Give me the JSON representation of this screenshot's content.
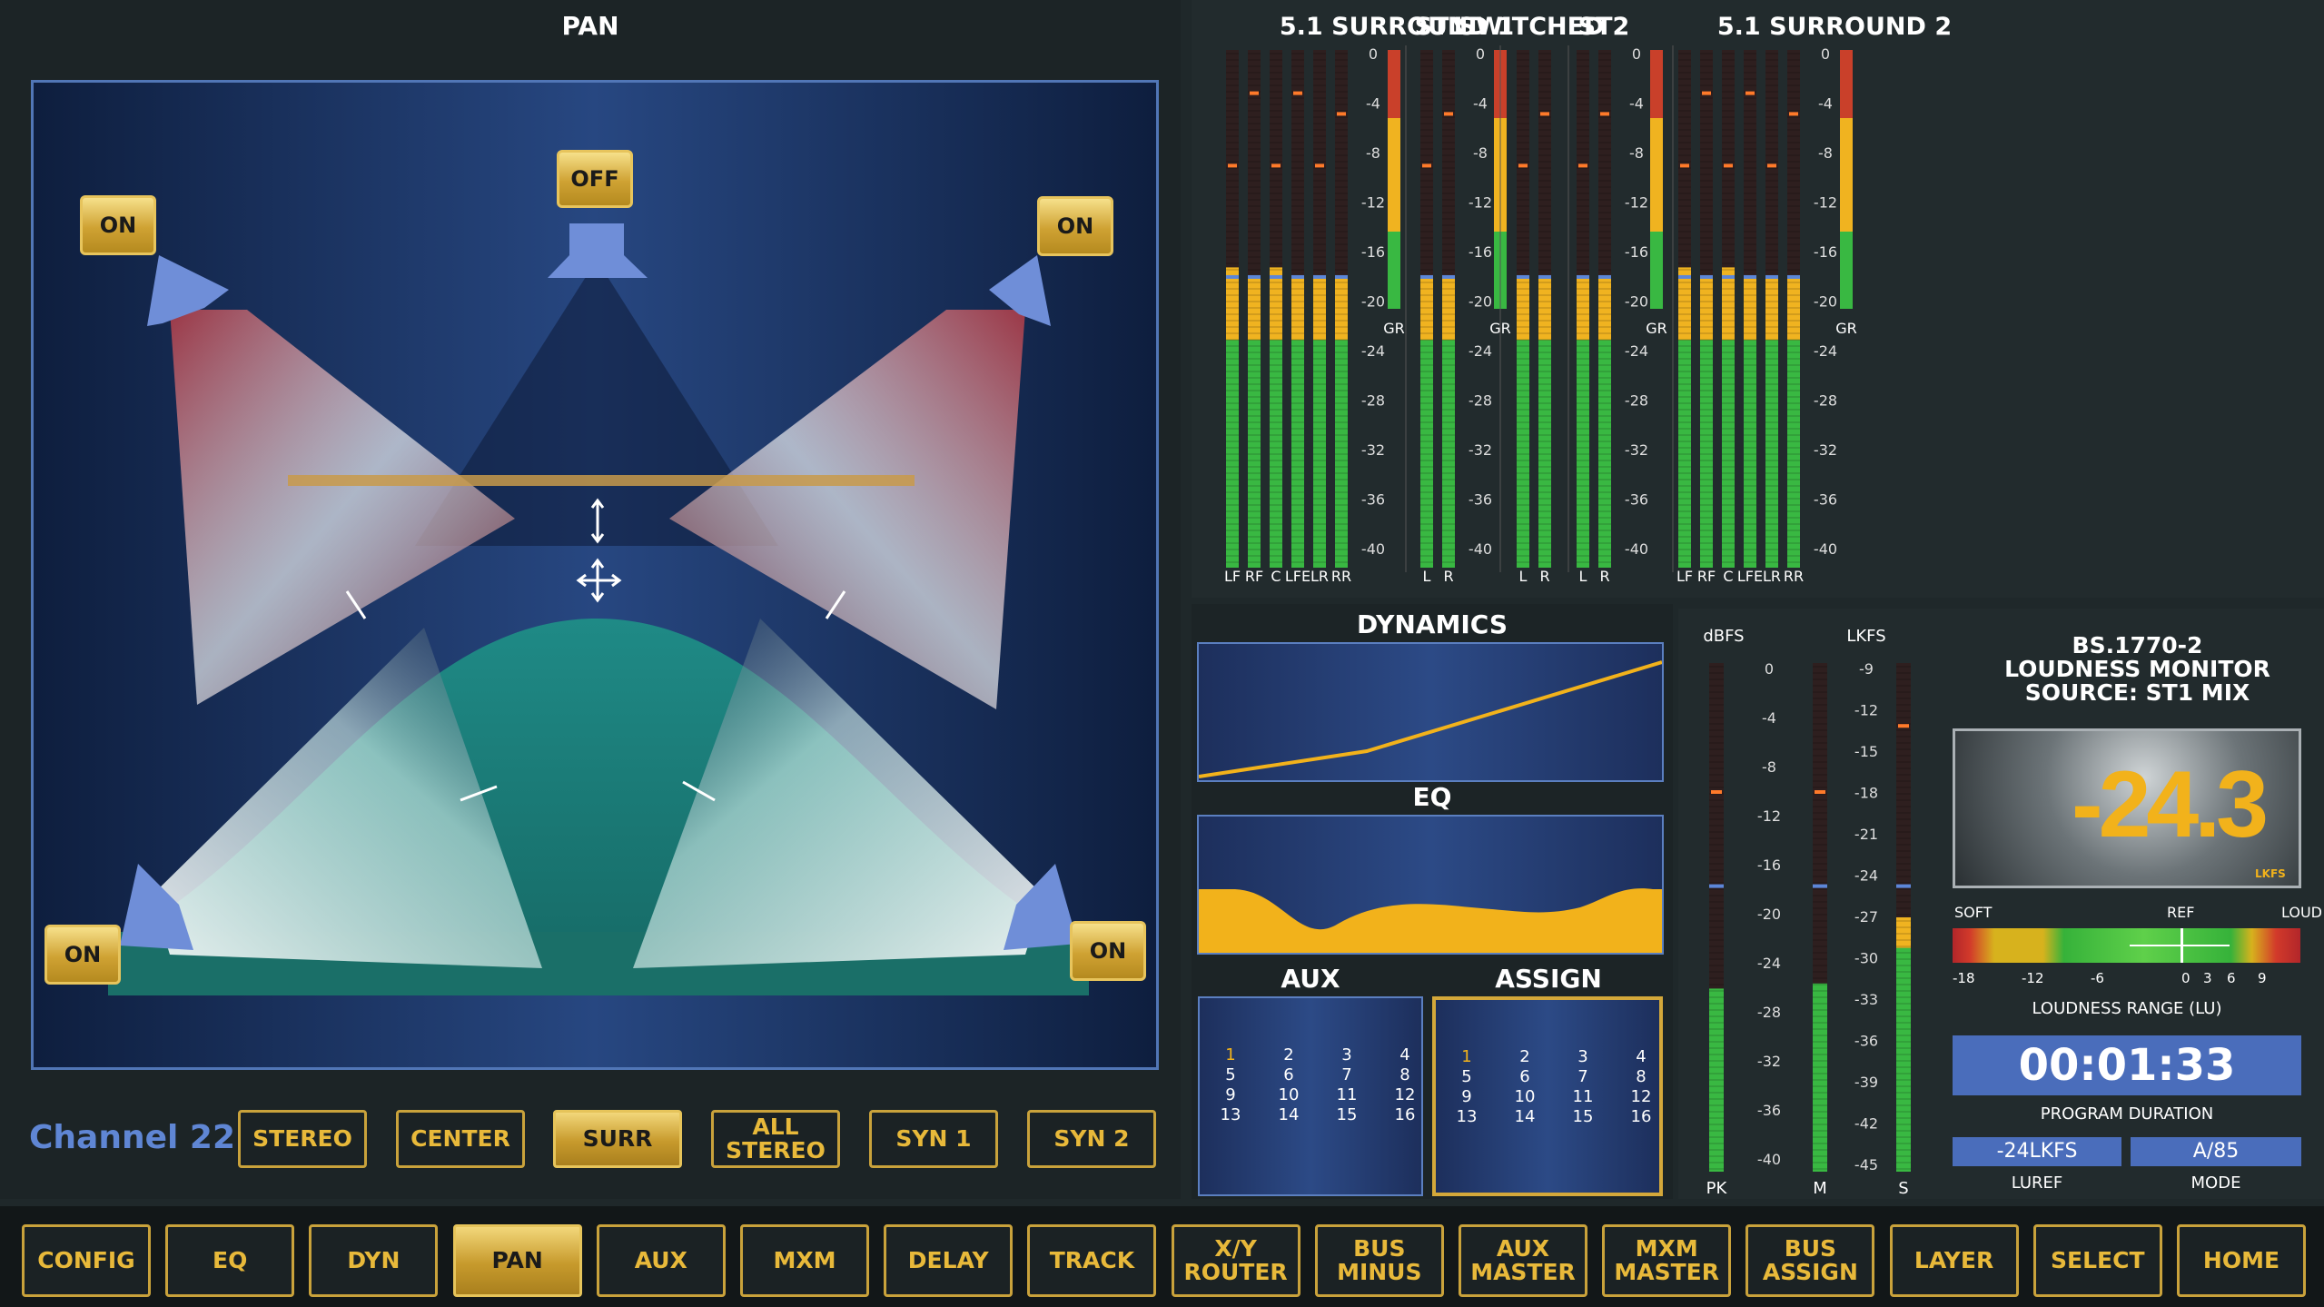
{
  "pan": {
    "title": "PAN",
    "channel": "Channel 22",
    "speakers": {
      "left_front": "ON",
      "center": "OFF",
      "right_front": "ON",
      "left_rear": "ON",
      "right_rear": "ON"
    },
    "modes": [
      "STEREO",
      "CENTER",
      "SURR",
      "ALL\nSTEREO",
      "SYN 1",
      "SYN 2"
    ],
    "active_mode": "SURR"
  },
  "meters": {
    "groups": [
      {
        "title": "5.1 SURROUND 1",
        "channels": [
          "LF",
          "RF",
          "C",
          "LFE",
          "LR",
          "RR"
        ]
      },
      {
        "title": "ST1",
        "channels": [
          "L",
          "R"
        ]
      },
      {
        "title": "SWITCHED",
        "channels": [
          "L",
          "R"
        ]
      },
      {
        "title": "ST2",
        "channels": [
          "L",
          "R"
        ]
      },
      {
        "title": "5.1 SURROUND 2",
        "channels": [
          "LF",
          "RF",
          "C",
          "LFE",
          "LR",
          "RR"
        ]
      }
    ],
    "scale": [
      "0",
      "-4",
      "-8",
      "-12",
      "-16",
      "-20",
      "-24",
      "-28",
      "-32",
      "-36",
      "-40"
    ],
    "gr_label": "GR"
  },
  "dynamics": {
    "title": "DYNAMICS"
  },
  "eq": {
    "title": "EQ"
  },
  "aux": {
    "title": "AUX",
    "numbers": [
      "1",
      "2",
      "3",
      "4",
      "5",
      "6",
      "7",
      "8",
      "9",
      "10",
      "11",
      "12",
      "13",
      "14",
      "15",
      "16"
    ],
    "highlight": "1"
  },
  "assign": {
    "title": "ASSIGN",
    "numbers": [
      "1",
      "2",
      "3",
      "4",
      "5",
      "6",
      "7",
      "8",
      "9",
      "10",
      "11",
      "12",
      "13",
      "14",
      "15",
      "16"
    ],
    "highlight": "1"
  },
  "loudness": {
    "dbfs_label": "dBFS",
    "lkfs_label": "LKFS",
    "dbfs_scale": [
      "0",
      "-4",
      "-8",
      "-12",
      "-16",
      "-20",
      "-24",
      "-28",
      "-32",
      "-36",
      "-40"
    ],
    "lkfs_scale": [
      "-9",
      "-12",
      "-15",
      "-18",
      "-21",
      "-24",
      "-27",
      "-30",
      "-33",
      "-36",
      "-39",
      "-42",
      "-45"
    ],
    "meter_labels": [
      "PK",
      "M",
      "S"
    ],
    "monitor_title_1": "BS.1770-2",
    "monitor_title_2": "LOUDNESS MONITOR",
    "monitor_title_3": "SOURCE: ST1 MIX",
    "value": "-24.3",
    "unit": "LKFS",
    "range_soft": "SOFT",
    "range_ref": "REF",
    "range_loud": "LOUD",
    "range_scale": [
      "-18",
      "-12",
      "-6",
      "0",
      "3",
      "6",
      "9"
    ],
    "range_label": "LOUDNESS RANGE (LU)",
    "duration": "00:01:33",
    "duration_label": "PROGRAM DURATION",
    "luref_value": "-24LKFS",
    "luref_label": "LUREF",
    "mode_value": "A/85",
    "mode_label": "MODE"
  },
  "bottom_nav": [
    "CONFIG",
    "EQ",
    "DYN",
    "PAN",
    "AUX",
    "MXM",
    "DELAY",
    "TRACK",
    "X/Y\nROUTER",
    "BUS\nMINUS",
    "AUX\nMASTER",
    "MXM\nMASTER",
    "BUS\nASSIGN",
    "LAYER",
    "SELECT",
    "HOME"
  ],
  "active_nav": "PAN"
}
